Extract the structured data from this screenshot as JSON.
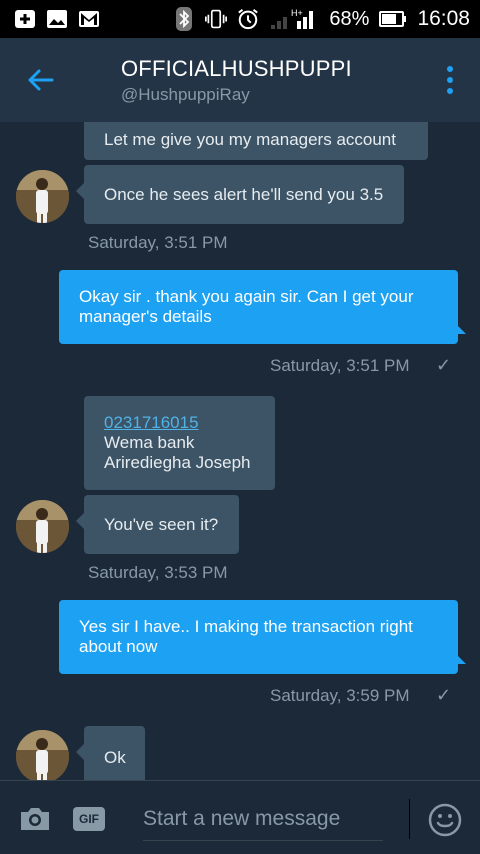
{
  "status_bar": {
    "signal_type": "H+",
    "battery_percent": "68%",
    "time": "16:08",
    "icons": [
      "add-box-icon",
      "image-icon",
      "gmail-icon",
      "bluetooth-icon",
      "vibrate-icon",
      "alarm-icon",
      "signal-icon",
      "battery-icon"
    ]
  },
  "header": {
    "title": "OFFICIALHUSHPUPPI",
    "handle": "@HushpuppiRay",
    "accent_color": "#1da1f2"
  },
  "messages": [
    {
      "direction": "in",
      "text": "Let me give you my managers account"
    },
    {
      "direction": "in",
      "text": "Once he sees alert he'll send you 3.5",
      "timestamp": "Saturday, 3:51 PM"
    },
    {
      "direction": "out",
      "text": "Okay sir . thank you again sir. Can I get your manager's details",
      "timestamp": "Saturday, 3:51 PM"
    },
    {
      "direction": "in",
      "link": "0231716015",
      "lines": [
        "Wema bank",
        "Arirediegha Joseph"
      ]
    },
    {
      "direction": "in",
      "text": "You've seen it?",
      "timestamp": "Saturday, 3:53 PM"
    },
    {
      "direction": "out",
      "text": "Yes sir I have.. I making the transaction right about now",
      "timestamp": "Saturday, 3:59 PM"
    },
    {
      "direction": "in",
      "text": "Ok"
    }
  ],
  "composer": {
    "placeholder": "Start a new message",
    "gif_label": "GIF"
  }
}
